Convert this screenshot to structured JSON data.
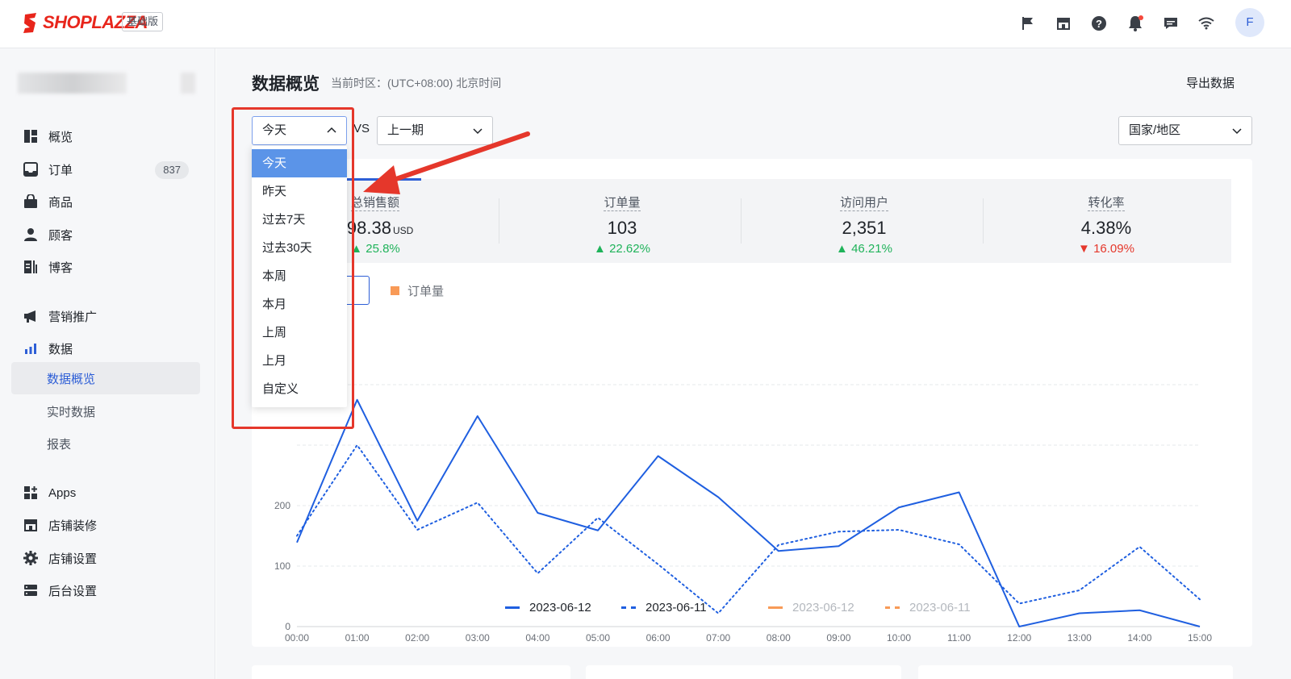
{
  "brand": {
    "name": "SHOPLAZZA",
    "plan_badge": "基础版",
    "avatar_letter": "F"
  },
  "topbar_icons": [
    "flag-icon",
    "store-icon",
    "help-icon",
    "bell-icon",
    "chat-icon",
    "wifi-icon"
  ],
  "sidebar": {
    "items": [
      {
        "label": "概览",
        "icon": "overview-icon"
      },
      {
        "label": "订单",
        "icon": "inbox-icon",
        "count": "837"
      },
      {
        "label": "商品",
        "icon": "bag-icon"
      },
      {
        "label": "顾客",
        "icon": "user-icon"
      },
      {
        "label": "博客",
        "icon": "blog-icon"
      },
      {
        "label": "营销推广",
        "icon": "megaphone-icon"
      },
      {
        "label": "数据",
        "icon": "bar-chart-icon"
      },
      {
        "label": "数据概览",
        "sub": true,
        "active": true
      },
      {
        "label": "实时数据",
        "sub": true
      },
      {
        "label": "报表",
        "sub": true
      },
      {
        "label": "Apps",
        "icon": "apps-icon"
      },
      {
        "label": "店铺装修",
        "icon": "storefront-icon"
      },
      {
        "label": "店铺设置",
        "icon": "gear-icon"
      },
      {
        "label": "后台设置",
        "icon": "server-icon"
      }
    ]
  },
  "header": {
    "title": "数据概览",
    "timezone": "当前时区：(UTC+08:00) 北京时间",
    "export_label": "导出数据"
  },
  "filters": {
    "period_value": "今天",
    "vs_label": "VS",
    "compare_value": "上一期",
    "region_value": "国家/地区"
  },
  "dropdown": {
    "options": [
      "今天",
      "昨天",
      "过去7天",
      "过去30天",
      "本周",
      "本月",
      "上周",
      "上月",
      "自定义"
    ],
    "selected": "今天"
  },
  "stats": [
    {
      "label": "总销售额",
      "value": "598.38",
      "unit": "USD",
      "delta": "25.8%",
      "direction": "up"
    },
    {
      "label": "订单量",
      "value": "103",
      "unit": "",
      "delta": "22.62%",
      "direction": "up"
    },
    {
      "label": "访问用户",
      "value": "2,351",
      "unit": "",
      "delta": "46.21%",
      "direction": "up"
    },
    {
      "label": "转化率",
      "value": "4.38%",
      "unit": "",
      "delta": "16.09%",
      "direction": "down"
    }
  ],
  "chart_toggle": {
    "secondary_label": "订单量"
  },
  "colors": {
    "primary": "#2d5ed6",
    "series_blue": "#1f5fe0",
    "series_orange": "#f89a57",
    "up": "#1fb35a",
    "down": "#e5372b",
    "highlight_frame": "#e5372b"
  },
  "chart_data": {
    "type": "line",
    "x": [
      "00:00",
      "01:00",
      "02:00",
      "03:00",
      "04:00",
      "05:00",
      "06:00",
      "07:00",
      "08:00",
      "09:00",
      "10:00",
      "11:00",
      "12:00",
      "13:00",
      "14:00",
      "15:00"
    ],
    "y_ticks": [
      "0",
      "100",
      "200"
    ],
    "ylim": [
      0,
      400
    ],
    "grid": true,
    "series": [
      {
        "name": "2023-06-12",
        "style": "solid",
        "color": "#1f5fe0",
        "active": true,
        "values": [
          139,
          375,
          175,
          348,
          188,
          159,
          282,
          214,
          125,
          133,
          197,
          222,
          0,
          22,
          27,
          0
        ]
      },
      {
        "name": "2023-06-11",
        "style": "dotted",
        "color": "#1f5fe0",
        "active": true,
        "values": [
          150,
          300,
          160,
          205,
          88,
          180,
          103,
          22,
          135,
          157,
          160,
          136,
          38,
          60,
          132,
          45
        ]
      },
      {
        "name": "2023-06-12",
        "style": "solid",
        "color": "#f89a57",
        "active": false,
        "values": []
      },
      {
        "name": "2023-06-11",
        "style": "dashed",
        "color": "#f89a57",
        "active": false,
        "values": []
      }
    ]
  }
}
